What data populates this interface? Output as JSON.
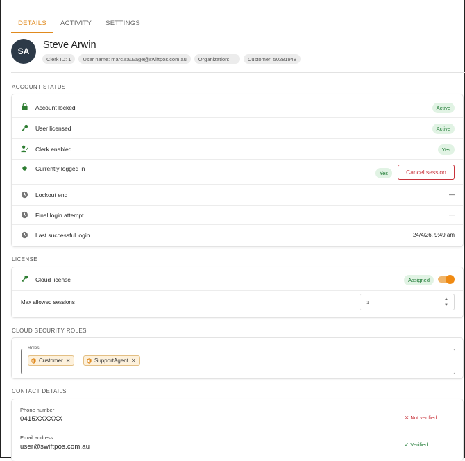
{
  "tabs": [
    {
      "label": "DETAILS"
    },
    {
      "label": "ACTIVITY"
    },
    {
      "label": "SETTINGS"
    }
  ],
  "user": {
    "initials": "SA",
    "name": "Steve Arwin",
    "chips": {
      "clerk_id": "Clerk ID: 1",
      "user_name": "User name: marc.sauvage@swiftpos.com.au",
      "organization": "Organization: —",
      "customer": "Customer: 50281948"
    }
  },
  "account_status": {
    "title": "ACCOUNT STATUS",
    "rows": [
      {
        "label": "Account locked",
        "icon": "lock-icon",
        "badge": "Active"
      },
      {
        "label": "User licensed",
        "icon": "key-icon",
        "badge": "Active"
      },
      {
        "label": "Clerk enabled",
        "icon": "person-check-icon",
        "badge": "Yes"
      },
      {
        "label": "Currently logged in",
        "icon": "dot-icon",
        "badge": "Yes",
        "action": "Cancel session"
      },
      {
        "label": "Lockout end",
        "icon": "clock-icon",
        "value": "—"
      },
      {
        "label": "Final login attempt",
        "icon": "clock-icon",
        "value": "—"
      },
      {
        "label": "Last successful login",
        "icon": "clock-icon",
        "value": "24/4/26, 9:49 am"
      }
    ]
  },
  "license": {
    "title": "LICENSE",
    "cloud_label": "Cloud license",
    "cloud_badge": "Assigned",
    "cloud_enabled": true,
    "max_sessions_label": "Max allowed sessions",
    "max_sessions_value": "1"
  },
  "roles": {
    "title": "CLOUD SECURITY ROLES",
    "field_label": "Roles",
    "items": [
      "Customer",
      "SupportAgent"
    ]
  },
  "contact": {
    "title": "CONTACT DETAILS",
    "phone_label": "Phone number",
    "phone_value": "0415XXXXXX",
    "phone_status": "Not verified",
    "email_label": "Email address",
    "email_value": "user@swiftpos.com.au",
    "email_status": "Verified"
  },
  "colors": {
    "accent": "#e08a1e",
    "success": "#1e7a34",
    "danger": "#c8323a",
    "avatar_bg": "#2d3a48"
  }
}
